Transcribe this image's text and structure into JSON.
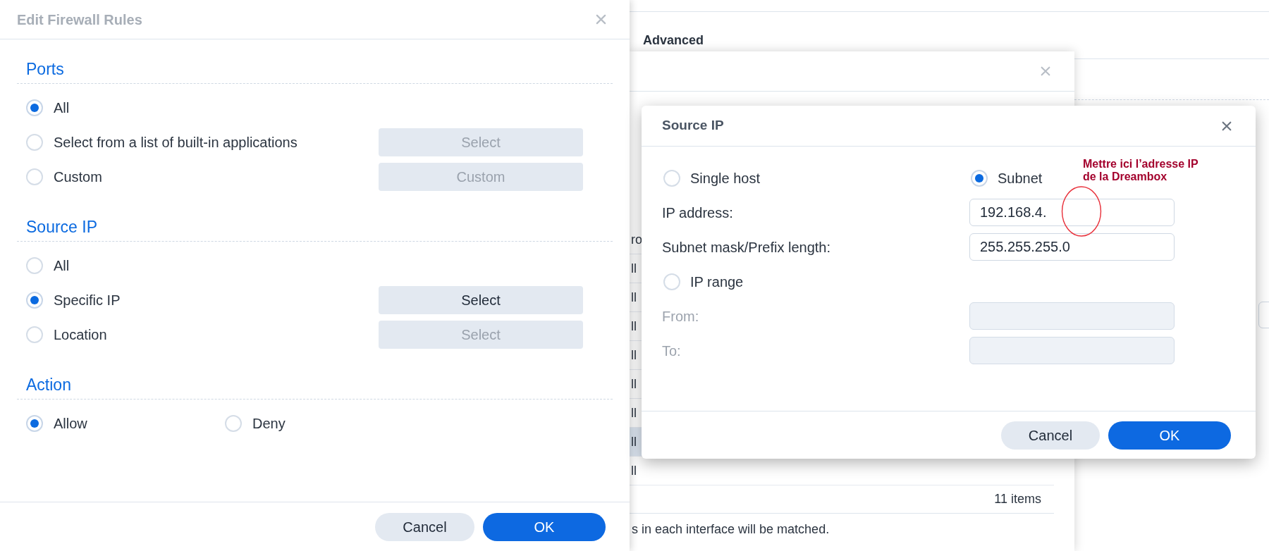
{
  "background": {
    "section_title": "Advanced",
    "rows": [
      {
        "text": "ro",
        "selected": false
      },
      {
        "text": "ll",
        "selected": false
      },
      {
        "text": "ll",
        "selected": false
      },
      {
        "text": "ll",
        "selected": false
      },
      {
        "text": "ll",
        "selected": false
      },
      {
        "text": "ll",
        "selected": false
      },
      {
        "text": "ll",
        "selected": false
      },
      {
        "text": "ll",
        "selected": true
      },
      {
        "text": "ll",
        "selected": false
      }
    ],
    "item_count": "11 items",
    "note": "s in each interface will be matched."
  },
  "edit_dialog": {
    "title": "Edit Firewall Rules",
    "sections": [
      {
        "title": "Ports",
        "kind": "stacked",
        "options": [
          {
            "label": "All",
            "selected": true
          },
          {
            "label": "Select from a list of built-in applications",
            "selected": false,
            "button": {
              "label": "Select",
              "disabled": true
            }
          },
          {
            "label": "Custom",
            "selected": false,
            "button": {
              "label": "Custom",
              "disabled": true
            }
          }
        ]
      },
      {
        "title": "Source IP",
        "kind": "stacked",
        "options": [
          {
            "label": "All",
            "selected": false
          },
          {
            "label": "Specific IP",
            "selected": true,
            "button": {
              "label": "Select",
              "disabled": false
            }
          },
          {
            "label": "Location",
            "selected": false,
            "button": {
              "label": "Select",
              "disabled": true
            }
          }
        ]
      },
      {
        "title": "Action",
        "kind": "inline",
        "options": [
          {
            "label": "Allow",
            "selected": true
          },
          {
            "label": "Deny",
            "selected": false
          }
        ]
      }
    ],
    "buttons": [
      {
        "label": "Cancel",
        "primary": false
      },
      {
        "label": "OK",
        "primary": true
      }
    ]
  },
  "source_ip_dialog": {
    "title": "Source IP",
    "rows": [
      {
        "kind": "radios",
        "options": [
          {
            "label": "Single host",
            "selected": false
          },
          {
            "label": "Subnet",
            "selected": true
          }
        ]
      },
      {
        "kind": "field",
        "label": "IP address:",
        "value": "192.168.4.",
        "disabled": false
      },
      {
        "kind": "field",
        "label": "Subnet mask/Prefix length:",
        "value": "255.255.255.0",
        "disabled": false
      },
      {
        "kind": "radios",
        "options": [
          {
            "label": "IP range",
            "selected": false
          }
        ]
      },
      {
        "kind": "field",
        "label": "From:",
        "disabled": true
      },
      {
        "kind": "field",
        "label": "To:",
        "disabled": true
      }
    ],
    "buttons": [
      {
        "label": "Cancel",
        "primary": false
      },
      {
        "label": "OK",
        "primary": true
      }
    ]
  },
  "annotation": {
    "text": "Mettre ici l’adresse IP de la Dreambox"
  }
}
